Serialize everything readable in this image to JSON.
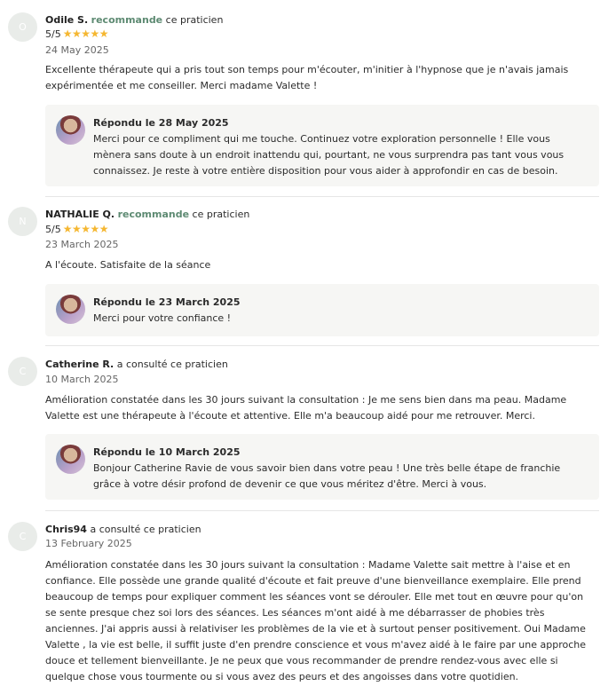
{
  "reviews": [
    {
      "initial": "O",
      "author": "Odile S.",
      "verb": "recommande",
      "suffix": " ce praticien",
      "rating": "5/5",
      "stars": "★★★★★",
      "date": "24 May 2025",
      "text": "Excellente thérapeute qui a pris tout son temps pour m'écouter, m'initier à l'hypnose que je n'avais jamais expérimentée et me conseiller. Merci madame Valette !",
      "reply_title": "Répondu le 28 May 2025",
      "reply_text": "Merci pour ce compliment qui me touche. Continuez votre exploration personnelle ! Elle vous mènera sans doute à un endroit inattendu qui, pourtant, ne vous surprendra pas tant vous vous connaissez. Je reste à votre entière disposition pour vous aider à approfondir en cas de besoin."
    },
    {
      "initial": "N",
      "author": "NATHALIE Q.",
      "verb": "recommande",
      "suffix": " ce praticien",
      "rating": "5/5",
      "stars": "★★★★★",
      "date": "23 March 2025",
      "text": "A l'écoute. Satisfaite de la séance",
      "reply_title": "Répondu le 23 March 2025",
      "reply_text": "Merci pour votre confiance !"
    },
    {
      "initial": "C",
      "author": "Catherine R.",
      "verb": "",
      "suffix": " a consulté ce praticien",
      "date": "10 March 2025",
      "text": "Amélioration constatée dans les 30 jours suivant la consultation : Je me sens bien dans ma peau. Madame Valette est une thérapeute à l'écoute et attentive. Elle m'a beaucoup aidé pour me retrouver. Merci.",
      "reply_title": "Répondu le 10 March 2025",
      "reply_text": "Bonjour Catherine Ravie de vous savoir bien dans votre peau ! Une très belle étape de franchie grâce à votre désir profond de devenir ce que vous méritez d'être. Merci à vous."
    },
    {
      "initial": "C",
      "author": "Chris94",
      "verb": "",
      "suffix": " a consulté ce praticien",
      "date": "13 February 2025",
      "text": "Amélioration constatée dans les 30 jours suivant la consultation : Madame Valette sait mettre à l'aise et en confiance. Elle possède une grande qualité d'écoute et fait preuve d'une bienveillance exemplaire. Elle prend beaucoup de temps pour expliquer comment les séances vont se dérouler. Elle met tout en œuvre pour qu'on se sente presque chez soi lors des séances. Les séances m'ont aidé à me débarrasser de phobies très anciennes. J'ai appris aussi à relativiser les problèmes de la vie et à surtout penser positivement. Oui Madame Valette , la vie est belle, il suffit juste d'en prendre conscience et vous m'avez aidé à le faire par une approche douce et tellement bienveillante. Je ne peux que vous recommander de prendre rendez-vous avec elle si quelque chose vous tourmente ou si vous avez des peurs et des angoisses dans votre quotidien."
    }
  ]
}
